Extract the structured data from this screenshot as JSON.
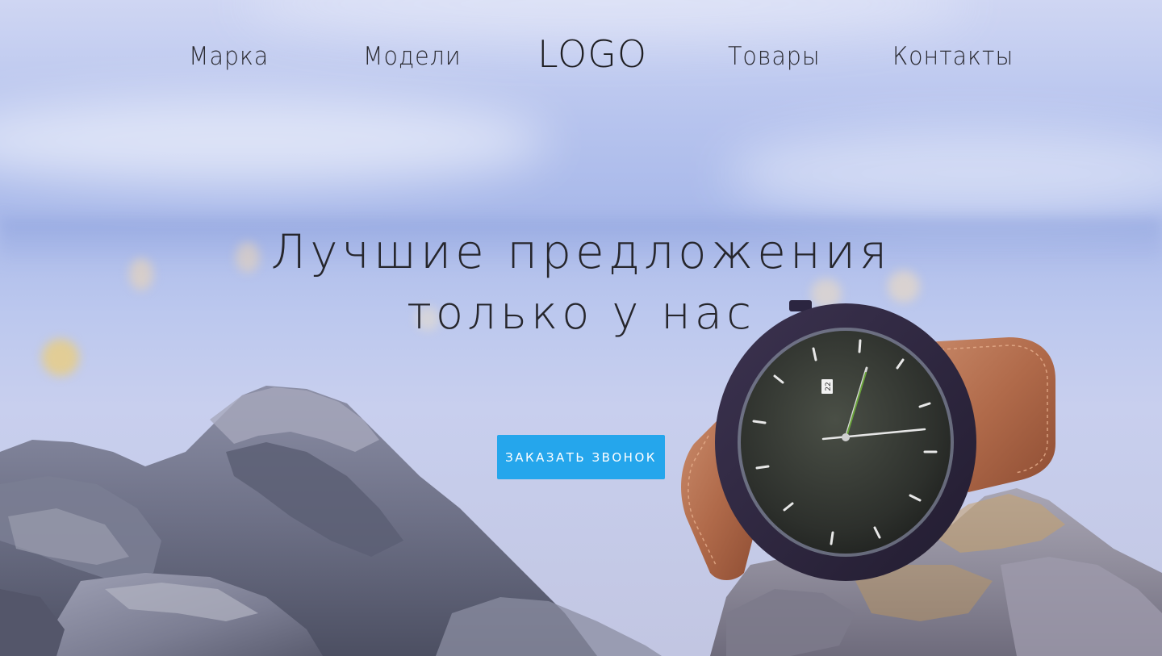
{
  "nav": {
    "links": [
      {
        "label": "Марка"
      },
      {
        "label": "Модели"
      },
      {
        "label": "Товары"
      },
      {
        "label": "Контакты"
      }
    ],
    "logo": "LOGO"
  },
  "hero": {
    "headline_line1": "Лучшие предложения",
    "headline_line2": "только у нас",
    "cta_label": "ЗАКАЗАТЬ ЗВОНОК",
    "watch_date": "22"
  },
  "colors": {
    "accent": "#25a6ec",
    "text": "#26262c",
    "sky": "#b7c4ee"
  },
  "icons": [
    "watch-image",
    "rocks-image"
  ]
}
